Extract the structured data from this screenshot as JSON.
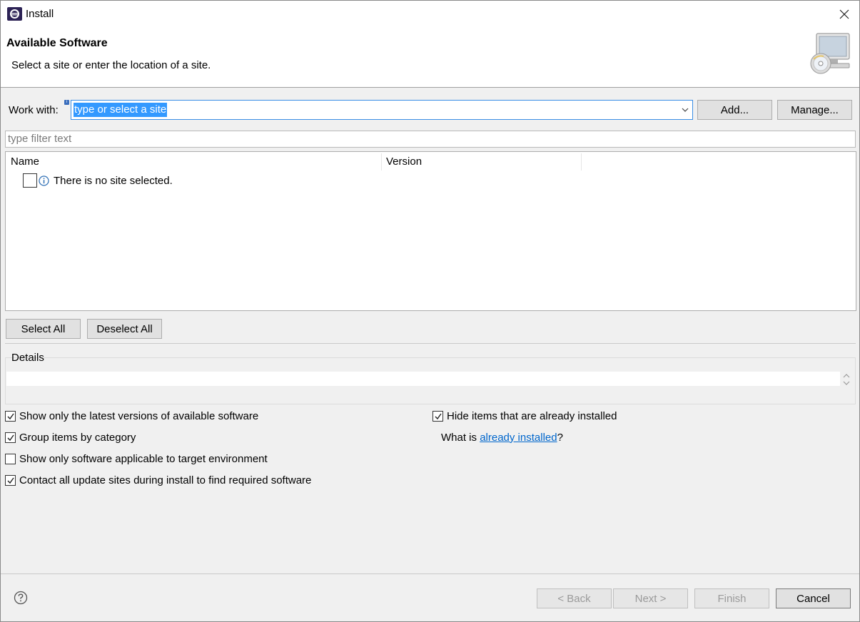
{
  "window": {
    "title": "Install",
    "icon": "eclipse-icon",
    "close_icon": "close-icon"
  },
  "banner": {
    "title": "Available Software",
    "description": "Select a site or enter the location of a site.",
    "image": "install-cd-monitor-icon"
  },
  "work_with": {
    "label": "Work with:",
    "info_marker": "i",
    "value": "type or select a site",
    "add_label": "Add...",
    "manage_label": "Manage..."
  },
  "filter": {
    "placeholder": "type filter text"
  },
  "tree": {
    "columns": [
      "Name",
      "Version"
    ],
    "rows": [
      {
        "checked": false,
        "icon": "info-icon",
        "text": "There is no site selected."
      }
    ]
  },
  "selection": {
    "select_all_label": "Select All",
    "deselect_all_label": "Deselect All"
  },
  "details": {
    "label": "Details",
    "text": ""
  },
  "options": {
    "latest_versions": {
      "label": "Show only the latest versions of available software",
      "checked": true
    },
    "group_by_category": {
      "label": "Group items by category",
      "checked": true
    },
    "applicable_only": {
      "label": "Show only software applicable to target environment",
      "checked": false
    },
    "contact_all_sites": {
      "label": "Contact all update sites during install to find required software",
      "checked": true
    },
    "hide_installed": {
      "label": "Hide items that are already installed",
      "checked": true
    },
    "what_is_prefix": "What is ",
    "what_is_link": "already installed",
    "what_is_suffix": "?"
  },
  "footer": {
    "help_icon": "help-icon",
    "back_label": "< Back",
    "next_label": "Next >",
    "finish_label": "Finish",
    "cancel_label": "Cancel"
  },
  "colors": {
    "accent": "#3399ff",
    "link": "#0066cc",
    "dialog_bg": "#f0f0f0"
  }
}
